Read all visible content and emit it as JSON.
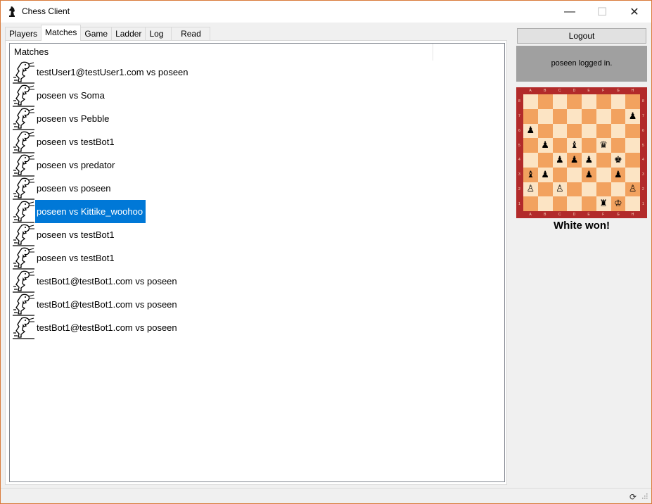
{
  "window": {
    "title": "Chess Client",
    "icon": "chess-knight-icon"
  },
  "tabs": [
    {
      "label": "Players"
    },
    {
      "label": "Matches",
      "active": true
    },
    {
      "label": "Game"
    },
    {
      "label": "Ladder"
    },
    {
      "label": "Log"
    },
    {
      "label": "Read me!"
    }
  ],
  "matches": {
    "header": "Matches",
    "items": [
      {
        "label": "testUser1@testUser1.com vs poseen"
      },
      {
        "label": "poseen vs Soma"
      },
      {
        "label": "poseen vs Pebble"
      },
      {
        "label": "poseen vs testBot1"
      },
      {
        "label": "poseen vs predator"
      },
      {
        "label": "poseen vs poseen"
      },
      {
        "label": "poseen vs Kittike_woohoo",
        "selected": true
      },
      {
        "label": "poseen vs testBot1"
      },
      {
        "label": "poseen vs testBot1"
      },
      {
        "label": "testBot1@testBot1.com vs poseen"
      },
      {
        "label": "testBot1@testBot1.com vs poseen"
      },
      {
        "label": "testBot1@testBot1.com vs poseen"
      }
    ]
  },
  "side": {
    "logout_label": "Logout",
    "status_text": "poseen logged in.",
    "result_text": "White won!"
  },
  "board": {
    "files": [
      "A",
      "B",
      "C",
      "D",
      "E",
      "F",
      "G",
      "H"
    ],
    "ranks": [
      "8",
      "7",
      "6",
      "5",
      "4",
      "3",
      "2",
      "1"
    ],
    "pieces": [
      {
        "square": "h7",
        "glyph": "♟"
      },
      {
        "square": "a6",
        "glyph": "♟"
      },
      {
        "square": "b5",
        "glyph": "♟"
      },
      {
        "square": "d5",
        "glyph": "♝"
      },
      {
        "square": "f5",
        "glyph": "♛"
      },
      {
        "square": "c4",
        "glyph": "♟"
      },
      {
        "square": "d4",
        "glyph": "♟"
      },
      {
        "square": "e4",
        "glyph": "♟"
      },
      {
        "square": "g4",
        "glyph": "♚"
      },
      {
        "square": "a3",
        "glyph": "♝"
      },
      {
        "square": "b3",
        "glyph": "♟"
      },
      {
        "square": "e3",
        "glyph": "♟"
      },
      {
        "square": "g3",
        "glyph": "♟"
      },
      {
        "square": "a2",
        "glyph": "♙"
      },
      {
        "square": "c2",
        "glyph": "♙"
      },
      {
        "square": "h2",
        "glyph": "♙"
      },
      {
        "square": "f1",
        "glyph": "♜"
      },
      {
        "square": "g1",
        "glyph": "♔"
      }
    ]
  },
  "colors": {
    "selection": "#0078d7",
    "board_frame": "#b22a2a",
    "light_square": "#fce4c4",
    "dark_square": "#f2a25f"
  }
}
